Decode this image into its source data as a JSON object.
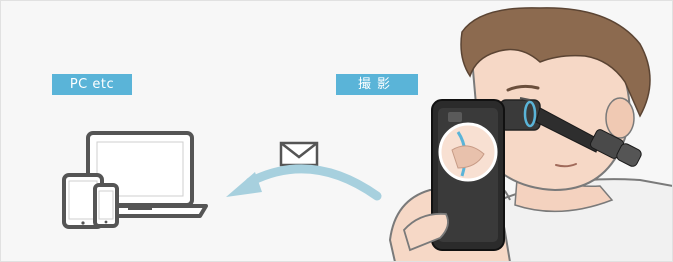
{
  "labels": {
    "pc": "PC etc",
    "capture": "撮影"
  },
  "colors": {
    "accent": "#5ab4d8",
    "arrow": "#a7d0de",
    "device_outline": "#555555",
    "background": "#f7f7f7"
  },
  "icons": [
    "envelope-icon",
    "transfer-arrow-icon",
    "laptop-icon",
    "tablet-icon",
    "smartphone-icon",
    "otoscope-icon"
  ]
}
